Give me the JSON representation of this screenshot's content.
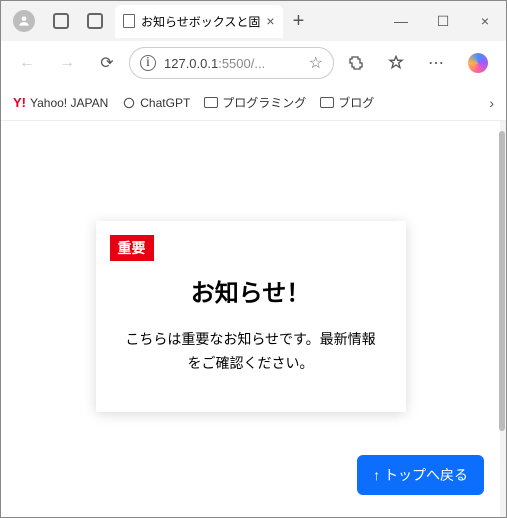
{
  "window": {
    "tab_title": "お知らせボックスと固",
    "minimize": "—",
    "maximize": "☐",
    "close": "×",
    "newtab": "+"
  },
  "toolbar": {
    "back": "←",
    "forward": "→",
    "reload": "⟳",
    "address_host": "127.0.0.1",
    "address_path": ":5500/...",
    "menu": "⋯"
  },
  "bookmarks": {
    "yahoo_prefix": "Y!",
    "yahoo": "Yahoo! JAPAN",
    "chatgpt": "ChatGPT",
    "programming": "プログラミング",
    "blog": "ブログ",
    "overflow": "›"
  },
  "page": {
    "badge": "重要",
    "title": "お知らせ！",
    "text": "こちらは重要なお知らせです。最新情報をご確認ください。",
    "back_to_top": "↑ トップへ戻る"
  }
}
